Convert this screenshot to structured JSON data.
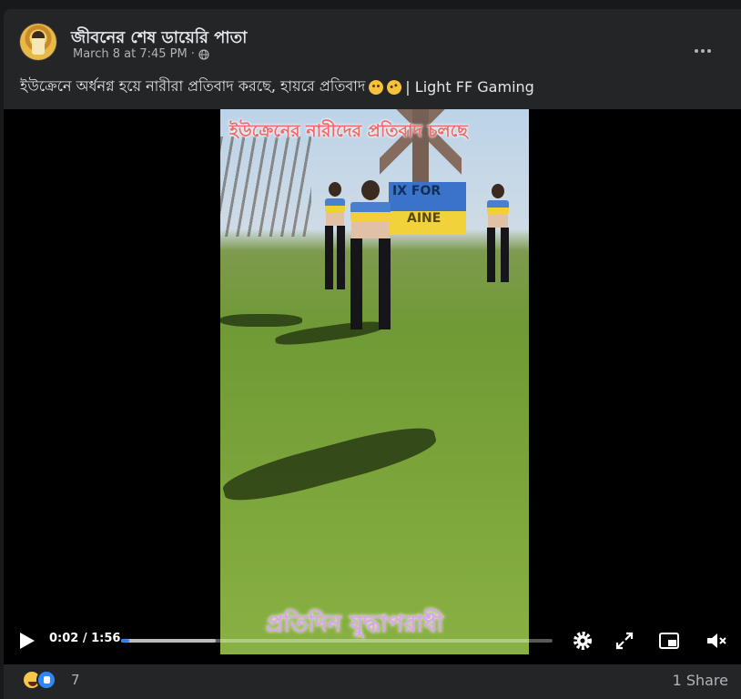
{
  "post": {
    "page_name": "জীবনের শেষ ডায়েরি পাতা",
    "date": "March 8 at 7:45 PM",
    "separator": "·",
    "caption_text": "ইউক্রেনে অর্ধনগ্ন হয়ে নারীরা প্রতিবাদ করছে, হায়রে প্রতিবাদ",
    "caption_suffix": "| Light FF Gaming",
    "audience_icon": "globe-icon",
    "more_icon": "more-options-icon"
  },
  "video": {
    "overlay_top": "ইউক্রেনের নারীদের প্রতিবাদ চলছে",
    "overlay_bottom": "প্রতিদিন যুদ্ধাপরাধী",
    "banner_line1": "IX FOR",
    "banner_line2": "AINE",
    "time_display": "0:02 / 1:56",
    "progress_fraction": 0.02,
    "buffered_fraction": 0.22,
    "progress_color": "#2d88ff",
    "controls": {
      "play_icon": "play-icon",
      "settings_icon": "gear-icon",
      "fullscreen_icon": "expand-icon",
      "pip_icon": "picture-in-picture-icon",
      "mute_icon": "muted-speaker-icon"
    }
  },
  "footer": {
    "reaction_count": "7",
    "shares": "1 Share",
    "reaction_icons": [
      "haha-icon",
      "like-icon"
    ]
  }
}
